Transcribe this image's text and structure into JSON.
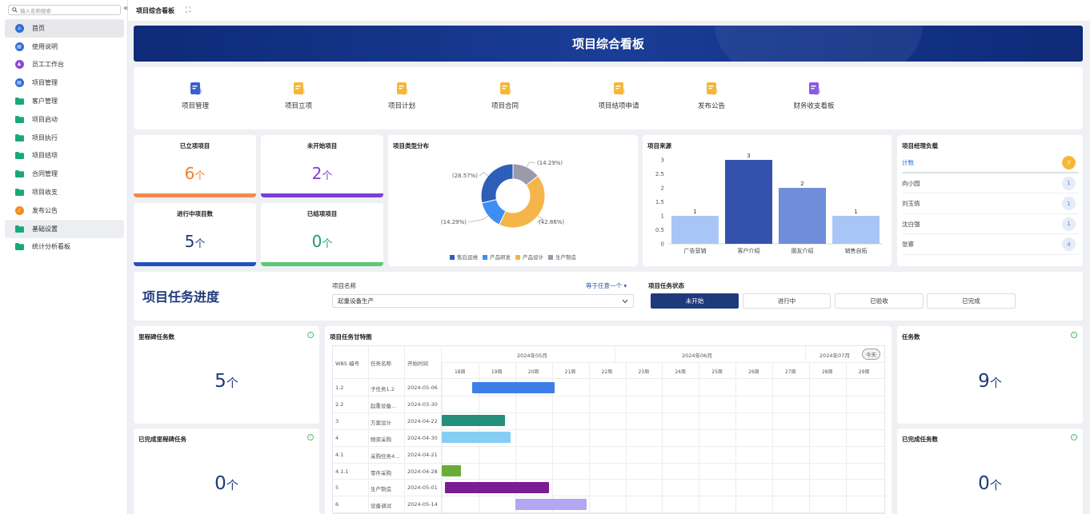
{
  "sidebar": {
    "search_placeholder": "输入名称搜索",
    "collapse": "«",
    "items": [
      {
        "label": "首页",
        "icon": "home-icon",
        "color": "#2f6fd6"
      },
      {
        "label": "使用说明",
        "icon": "doc-icon",
        "color": "#2f6fd6"
      },
      {
        "label": "员工工作台",
        "icon": "person-icon",
        "color": "#8f47d6"
      },
      {
        "label": "项目管理",
        "icon": "doc-icon",
        "color": "#2f6fd6"
      },
      {
        "label": "客户管理",
        "icon": "folder-icon",
        "color": "#19a87c"
      },
      {
        "label": "项目启动",
        "icon": "folder-icon",
        "color": "#19a87c"
      },
      {
        "label": "项目执行",
        "icon": "folder-icon",
        "color": "#19a87c"
      },
      {
        "label": "项目结项",
        "icon": "folder-icon",
        "color": "#19a87c"
      },
      {
        "label": "合同管理",
        "icon": "folder-icon",
        "color": "#19a87c"
      },
      {
        "label": "项目收支",
        "icon": "folder-icon",
        "color": "#19a87c"
      },
      {
        "label": "发布公告",
        "icon": "megaphone-icon",
        "color": "#f08a24"
      },
      {
        "label": "基础设置",
        "icon": "folder-icon",
        "color": "#19a87c"
      },
      {
        "label": "统计分析看板",
        "icon": "folder-icon",
        "color": "#19a87c"
      }
    ]
  },
  "topbar": {
    "title": "项目综合看板",
    "fullscreen": "⛶"
  },
  "banner": {
    "title": "项目综合看板"
  },
  "quick": [
    {
      "label": "项目管理",
      "icon": "project-icon",
      "color": "#3b5fd0"
    },
    {
      "label": "项目立项",
      "icon": "bubble-icon",
      "color": "#f5b73a"
    },
    {
      "label": "项目计划",
      "icon": "plan-icon",
      "color": "#f5b73a"
    },
    {
      "label": "项目合同",
      "icon": "contract-icon",
      "color": "#f5b73a"
    },
    {
      "label": "项目结项申请",
      "icon": "check-doc-icon",
      "color": "#f5b73a"
    },
    {
      "label": "发布公告",
      "icon": "bell-icon",
      "color": "#f5b73a"
    },
    {
      "label": "财务收支看板",
      "icon": "chart-icon",
      "color": "#8a5be0"
    }
  ],
  "stats": [
    {
      "title": "已立项项目",
      "value": "6",
      "unit": "个",
      "color": "#f07f2a",
      "bar": "#f08a4b"
    },
    {
      "title": "未开始项目",
      "value": "2",
      "unit": "个",
      "color": "#7a3ed6",
      "bar": "#7a3ed6"
    },
    {
      "title": "进行中项目数",
      "value": "5",
      "unit": "个",
      "color": "#1f3a7a",
      "bar": "#2450b8"
    },
    {
      "title": "已结项项目",
      "value": "0",
      "unit": "个",
      "color": "#1f9c7a",
      "bar": "#5cc870"
    }
  ],
  "pie": {
    "title": "项目类型分布",
    "slices": [
      {
        "name": "售后运维",
        "value": 28.57,
        "label": "(28.57%)",
        "color": "#2e5fb8"
      },
      {
        "name": "产品研发",
        "value": 14.29,
        "label": "(14.29%)",
        "color": "#3d8ef5"
      },
      {
        "name": "产品设计",
        "value": 42.86,
        "label": "(42.86%)",
        "color": "#f5b54a"
      },
      {
        "name": "生产制造",
        "value": 14.29,
        "label": "(14.29%)",
        "color": "#9a9aa8"
      }
    ]
  },
  "bar": {
    "title": "项目来源",
    "categories": [
      "广告营销",
      "客户介绍",
      "朋友介绍",
      "销售自拓"
    ],
    "values": [
      1,
      3,
      2,
      1
    ],
    "value_labels": [
      "1",
      "3",
      "2",
      "1"
    ],
    "colors": [
      "#a8c6f5",
      "#3452ad",
      "#6f8dd8",
      "#a8c6f5"
    ],
    "yticks": [
      "0",
      "0.5",
      "1",
      "1.5",
      "2",
      "2.5",
      "3"
    ],
    "ylim": [
      0,
      3
    ]
  },
  "managers": {
    "title": "项目经理负载",
    "header": {
      "name": "计数",
      "count": "7"
    },
    "rows": [
      {
        "name": "向小园",
        "count": "1"
      },
      {
        "name": "刘玉倩",
        "count": "1"
      },
      {
        "name": "沈白强",
        "count": "1"
      },
      {
        "name": "张睿",
        "count": "4"
      }
    ]
  },
  "task_progress": {
    "title": "项目任务进度",
    "project_label": "项目名称",
    "filter": "等于任意一个 ▾",
    "project_value": "起重设备生产",
    "status_label": "项目任务状态",
    "statuses": [
      "未开始",
      "进行中",
      "已验收",
      "已完成"
    ]
  },
  "kpis": {
    "milestone": {
      "title": "里程碑任务数",
      "value": "5",
      "unit": "个"
    },
    "milestone_done": {
      "title": "已完成里程碑任务",
      "value": "0",
      "unit": "个"
    },
    "tasks": {
      "title": "任务数",
      "value": "9",
      "unit": "个"
    },
    "tasks_done": {
      "title": "已完成任务数",
      "value": "0",
      "unit": "个"
    },
    "info": "i"
  },
  "gantt": {
    "title": "项目任务甘特图",
    "columns": [
      "WBS 编号",
      "任务名称",
      "开始时间"
    ],
    "months": [
      "2024年05月",
      "2024年06月",
      "2024年07月"
    ],
    "today": "今天",
    "weeks": [
      "18周",
      "19周",
      "20周",
      "21周",
      "22周",
      "23周",
      "24周",
      "25周",
      "26周",
      "27周",
      "28周",
      "29周"
    ],
    "rows": [
      {
        "wbs": "1.2",
        "name": "子任务1.2",
        "start": "2024-05-06",
        "bar_color": "#3d7ee8"
      },
      {
        "wbs": "2.2",
        "name": "起重设备...",
        "start": "2024-03-30",
        "bar_color": ""
      },
      {
        "wbs": "3",
        "name": "方案设计",
        "start": "2024-04-22",
        "bar_color": "#22907d"
      },
      {
        "wbs": "4",
        "name": "物资采购",
        "start": "2024-04-30",
        "bar_color": "#84cdf3"
      },
      {
        "wbs": "4.1",
        "name": "采购任务4...",
        "start": "2024-04-21",
        "bar_color": ""
      },
      {
        "wbs": "4.1.1",
        "name": "零件采购",
        "start": "2024-04-28",
        "bar_color": "#6aad36"
      },
      {
        "wbs": "5",
        "name": "生产制造",
        "start": "2024-05-01",
        "bar_color": "#7a1c93"
      },
      {
        "wbs": "6",
        "name": "设备调试",
        "start": "2024-05-14",
        "bar_color": "#b3a6f3"
      }
    ]
  }
}
